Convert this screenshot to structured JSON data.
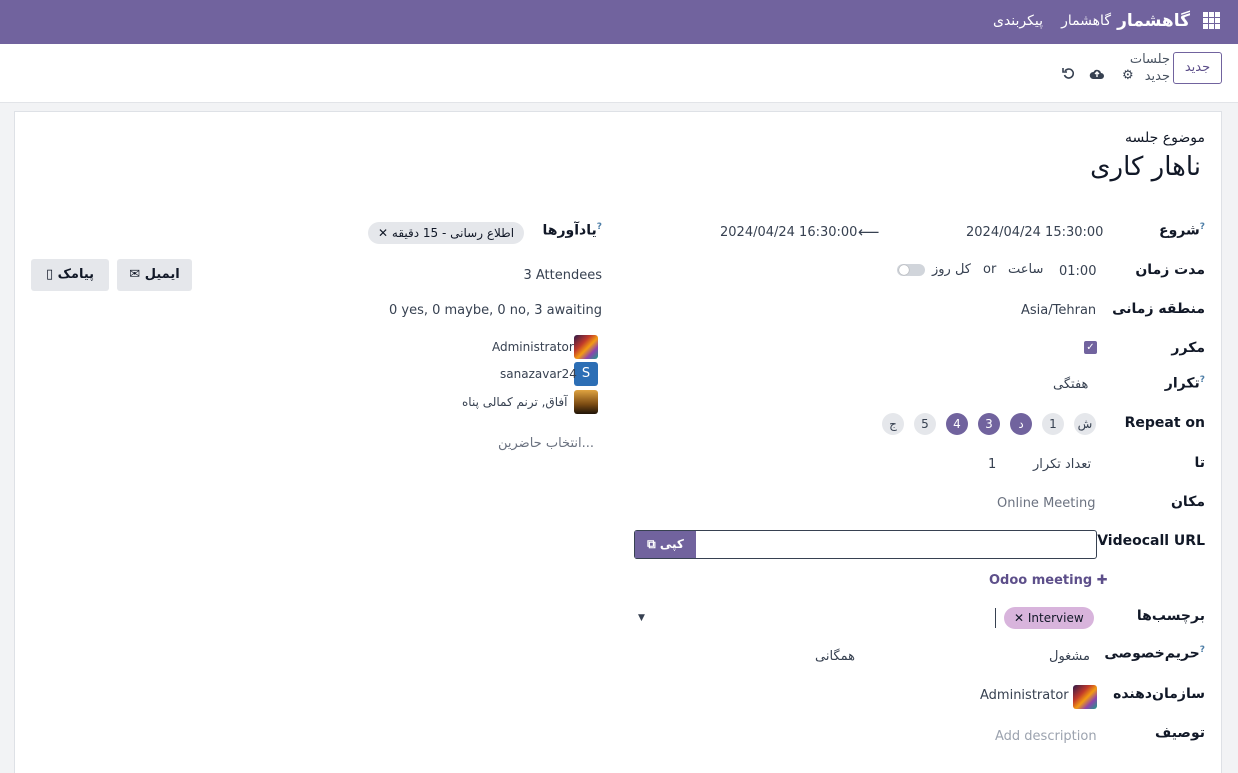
{
  "nav": {
    "app_name": "گاهشمار",
    "menu_items": [
      "گاهشمار",
      "پیکربندی"
    ]
  },
  "control": {
    "new_button": "جدید",
    "breadcrumb_parent": "جلسات",
    "breadcrumb_current": "جدید"
  },
  "form": {
    "subject_label": "موضوع جلسه",
    "subject_value": "ناهار کاری",
    "start": {
      "label": "شروع",
      "help": "?",
      "start_value": "2024/04/24 15:30:00",
      "arrow": "⟵",
      "end_value": "2024/04/24 16:30:00"
    },
    "duration": {
      "label": "مدت زمان",
      "value": "01:00",
      "unit": "ساعت",
      "or": "or",
      "allday": "کل روز"
    },
    "timezone": {
      "label": "منطقه زمانی",
      "value": "Asia/Tehran"
    },
    "recurrent": {
      "label": "مکرر"
    },
    "repeat": {
      "label": "تکرار",
      "help": "?",
      "value": "هفتگی"
    },
    "repeat_on": {
      "label": "Repeat on",
      "days": [
        {
          "label": "ش",
          "active": false
        },
        {
          "label": "1",
          "active": false
        },
        {
          "label": "د",
          "active": true
        },
        {
          "label": "3",
          "active": true
        },
        {
          "label": "4",
          "active": true
        },
        {
          "label": "5",
          "active": false
        },
        {
          "label": "ج",
          "active": false
        }
      ]
    },
    "until": {
      "label": "تا",
      "type": "تعداد تکرار",
      "count": "1"
    },
    "location": {
      "label": "مکان",
      "value": "Online Meeting"
    },
    "videocall": {
      "label": "Videocall URL",
      "value": "",
      "copy_label": "کپی",
      "odoo_meeting": "Odoo meeting"
    },
    "tags": {
      "label": "برچسب‌ها",
      "items": [
        "Interview"
      ]
    },
    "privacy": {
      "label": "حریم‌خصوصی",
      "help": "?",
      "show_as": "مشغول",
      "privacy_value": "همگانی"
    },
    "organizer": {
      "label": "سازمان‌دهنده",
      "value": "Administrator"
    },
    "description": {
      "label": "توصیف",
      "placeholder": "Add description"
    },
    "alarms": {
      "label": "یادآورها",
      "help": "?",
      "items": [
        "اطلاع رسانی - 15 دقیقه"
      ]
    },
    "attendees": {
      "count_text": "3 Attendees",
      "status_text": "0 yes, 0 maybe, 0 no, 3 awaiting",
      "people": [
        "Administrator",
        "sanazavar24",
        "آفاق, ترنم کمالی پناه"
      ],
      "s_initial": "S",
      "select_placeholder": "انتخاب حاضرین..."
    },
    "actions": {
      "email": "ایمیل",
      "sms": "پیامک"
    }
  },
  "colors": {
    "brand": "#71639e",
    "tag_interview": "#d8b4dc"
  }
}
